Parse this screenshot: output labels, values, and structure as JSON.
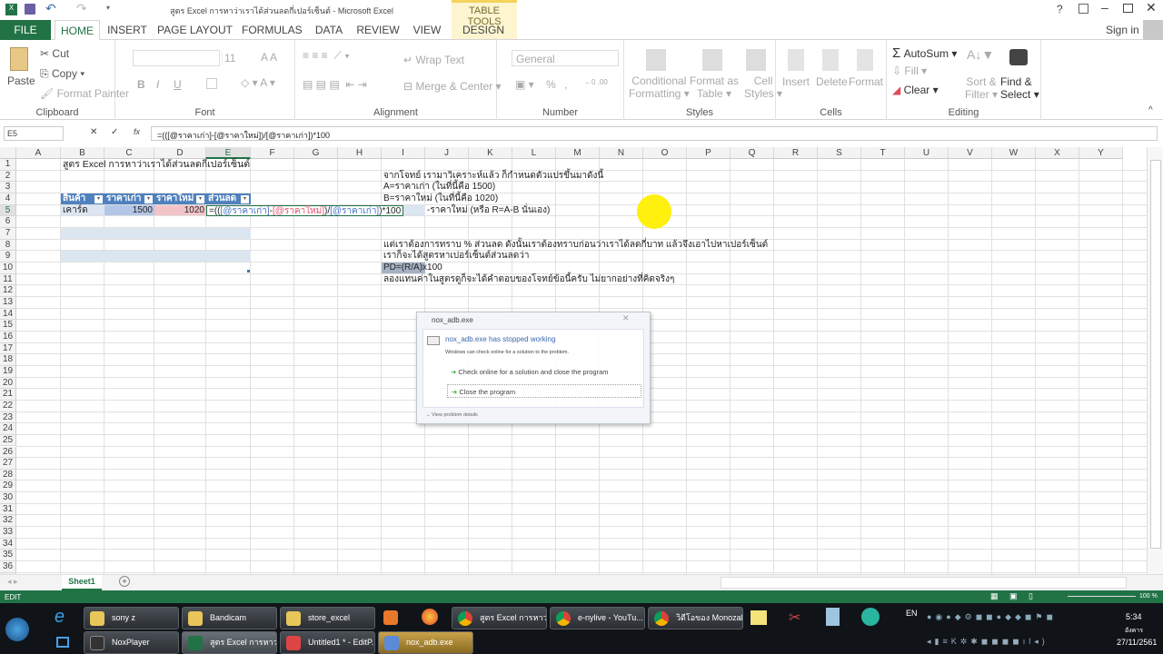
{
  "window": {
    "title": "สูตร Excel การหาว่าเราได้ส่วนลดกี่เปอร์เซ็นต์ - Microsoft Excel",
    "context_tab_group": "TABLE TOOLS",
    "help": "?",
    "sign_in": "Sign in"
  },
  "tabs": [
    "FILE",
    "HOME",
    "INSERT",
    "PAGE LAYOUT",
    "FORMULAS",
    "DATA",
    "REVIEW",
    "VIEW",
    "DESIGN"
  ],
  "ribbon": {
    "clipboard": {
      "label": "Clipboard",
      "paste": "Paste",
      "cut": "Cut",
      "copy": "Copy",
      "format_painter": "Format Painter"
    },
    "font": {
      "label": "Font",
      "size": "11",
      "bold": "B",
      "italic": "I",
      "underline": "U"
    },
    "alignment": {
      "label": "Alignment",
      "wrap_text": "Wrap Text",
      "merge_center": "Merge & Center"
    },
    "number": {
      "label": "Number",
      "format": "General",
      "percent": "%",
      "comma": ","
    },
    "styles": {
      "label": "Styles",
      "conditional": [
        "Conditional",
        "Formatting"
      ],
      "format_table": [
        "Format as",
        "Table"
      ],
      "cell_styles": [
        "Cell",
        "Styles"
      ]
    },
    "cells": {
      "label": "Cells",
      "insert": "Insert",
      "delete": "Delete",
      "format": "Format"
    },
    "editing": {
      "label": "Editing",
      "autosum": "AutoSum",
      "fill": "Fill",
      "clear": "Clear",
      "sort": [
        "Sort &",
        "Filter"
      ],
      "find": [
        "Find &",
        "Select"
      ]
    }
  },
  "formula_bar": {
    "name_box": "E5",
    "formula": "=(([@ราคาเก่า]-[@ราคาใหม่])/[@ราคาเก่า])*100",
    "cancel": "✕",
    "enter": "✓",
    "fx": "fx"
  },
  "columns": [
    "A",
    "B",
    "C",
    "D",
    "E",
    "F",
    "G",
    "H",
    "I",
    "J",
    "K",
    "L",
    "M",
    "N",
    "O",
    "P",
    "Q",
    "R",
    "S",
    "T",
    "U",
    "V",
    "W",
    "X",
    "Y"
  ],
  "cells": {
    "B1": "สูตร Excel การหาว่าเราได้ส่วนลดกี่เปอร์เซ็นต์",
    "I2": "จากโจทย์ เรามาวิเคราะห์แล้ว ก็กำหนดตัวแปรขึ้นมาดังนี้",
    "I3": "A=ราคาเก่า (ในที่นี้คือ 1500)",
    "I4": "B=ราคาใหม่ (ในที่นี้คือ 1020)",
    "J5": "-ราคาใหม่ (หรือ R=A-B นั่นเอง)",
    "I8": "แต่เราต้องการทราบ % ส่วนลด ดังนั้นเราต้องทราบก่อนว่าเราได้ลดกี่บาท แล้วจึงเอาไปหาเปอร์เซ็นต์",
    "I9": "เราก็จะได้สูตรหาเปอร์เซ็นต์ส่วนลดว่า",
    "I10": "PD=(R/A)x100",
    "I11": "ลองแทนค่าในสูตรดูก็จะได้คำตอบของโจทย์ข้อนี้ครับ ไม่ยากอย่างที่คิดจริงๆ"
  },
  "table": {
    "headers": [
      "สินค้า",
      "ราคาเก่า",
      "ราคาใหม่",
      "ส่วนลด"
    ],
    "row": [
      "เคาร์ด",
      "1500",
      "1020"
    ],
    "edit": {
      "p1": "=((",
      "r1": "[@ราคาเก่า]",
      "m1": "-",
      "r2": "[@ราคาใหม่]",
      "p2": ")/",
      "r3": "[@ราคาเก่า]",
      "p3": ")*100"
    }
  },
  "sheet_tabs": [
    "Sheet1"
  ],
  "status": {
    "mode": "EDIT",
    "zoom": "100 %"
  },
  "dialog": {
    "title": "nox_adb.exe",
    "heading": "nox_adb.exe has stopped working",
    "message": "Windows can check online for a solution to the problem.",
    "option1": "Check online for a solution and close the program",
    "option2": "Close the program",
    "details": "View problem details"
  },
  "taskbar": {
    "row1": [
      "sony z",
      "Bandicam",
      "store_excel",
      "สูตร Excel การหาว่า...",
      "e-nylive - YouTu...",
      "วิดีโอของ Monozab..."
    ],
    "row2": [
      "NoxPlayer",
      "สูตร Excel การหาว่า...",
      "Untitled1 * - EditP...",
      "nox_adb.exe"
    ],
    "lang": "EN",
    "time": "5:34",
    "day": "อังคาร",
    "date": "27/11/2561"
  }
}
